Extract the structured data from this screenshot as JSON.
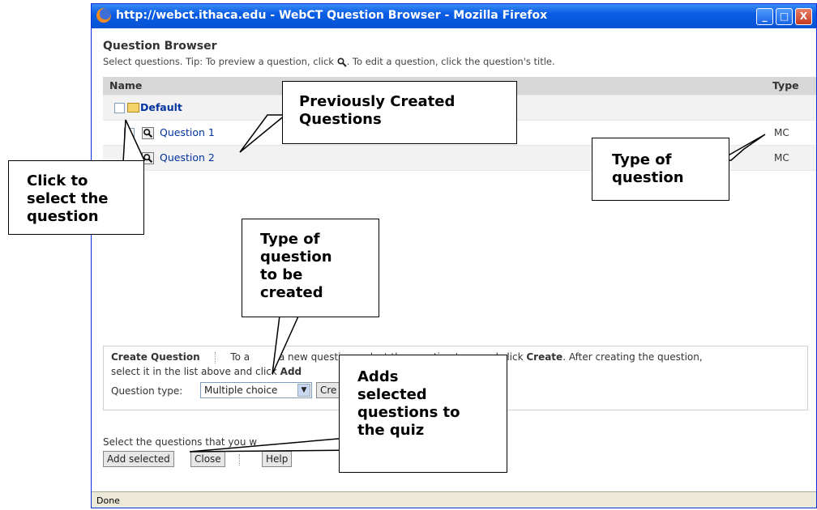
{
  "window": {
    "title": "http://webct.ithaca.edu - WebCT Question Browser - Mozilla Firefox",
    "buttons": {
      "minimize": "_",
      "maximize": "□",
      "close": "X"
    }
  },
  "browser": {
    "heading": "Question Browser",
    "tip_part1": "Select questions. Tip: To preview a question, click ",
    "tip_part2": ". To edit a question, click the question's title.",
    "columns": {
      "name": "Name",
      "type": "Type"
    },
    "folder": {
      "label": "Default"
    },
    "questions": [
      {
        "title": "Question 1",
        "type": "MC"
      },
      {
        "title": "Question 2",
        "type": "MC"
      }
    ]
  },
  "create": {
    "label": "Create Question",
    "desc1_a": "To a",
    "desc1_b": "a new question, select the question type and click ",
    "desc1_c": "Create",
    "desc1_d": ". After creating the question,",
    "desc2_a": "select it in the list above and click ",
    "desc2_b": "Add",
    "type_label": "Question type:",
    "type_value": "Multiple choice",
    "create_button": "Cre"
  },
  "footer": {
    "select_text": "Select the questions that you w",
    "add_selected": "Add selected",
    "close": "Close",
    "help": "Help"
  },
  "status": {
    "text": "Done"
  },
  "callouts": {
    "previously_created": [
      "Previously Created",
      "Questions"
    ],
    "type_of_question": [
      "Type of",
      "question"
    ],
    "click_to_select": [
      "Click to",
      "select the",
      "question"
    ],
    "type_to_be_created": [
      "Type of",
      "question",
      "to be",
      "created"
    ],
    "adds_selected": [
      "Adds",
      "selected",
      "questions to",
      "the quiz"
    ]
  }
}
